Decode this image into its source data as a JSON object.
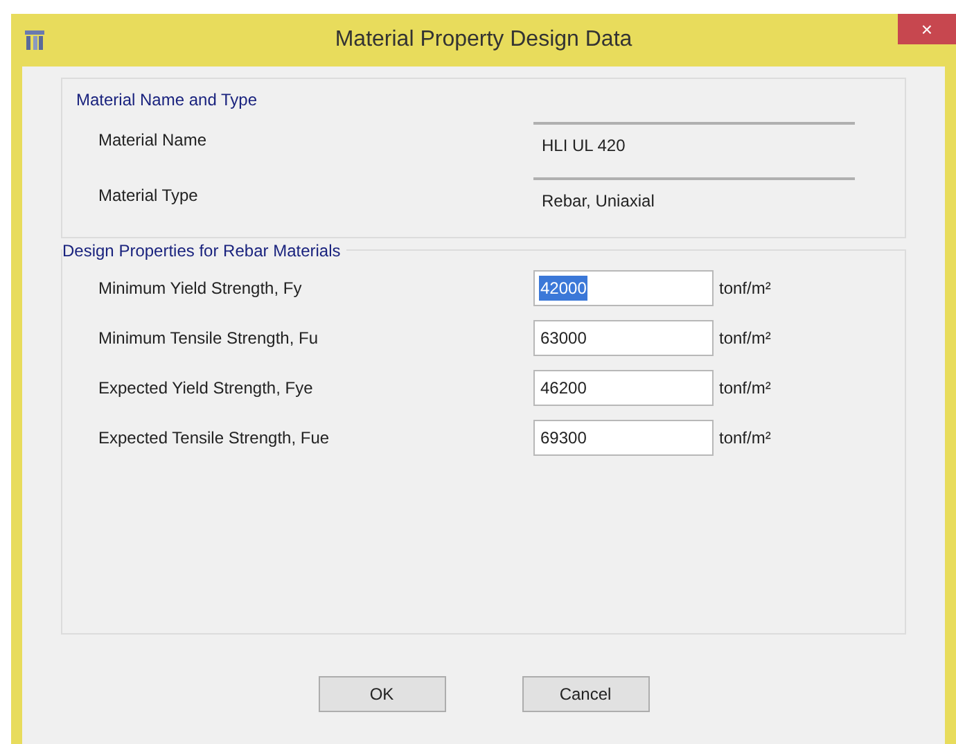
{
  "window": {
    "title": "Material Property Design Data",
    "close": "×"
  },
  "name_type_group": {
    "title": "Material Name and Type",
    "rows": [
      {
        "label": "Material Name",
        "value": "HLI UL 420"
      },
      {
        "label": "Material Type",
        "value": "Rebar, Uniaxial"
      }
    ]
  },
  "design_group": {
    "title": "Design Properties for Rebar Materials",
    "rows": [
      {
        "label": "Minimum Yield Strength, Fy",
        "value": "42000",
        "unit": "tonf/m²",
        "selected": true
      },
      {
        "label": "Minimum Tensile Strength, Fu",
        "value": "63000",
        "unit": "tonf/m²",
        "selected": false
      },
      {
        "label": "Expected Yield Strength, Fye",
        "value": "46200",
        "unit": "tonf/m²",
        "selected": false
      },
      {
        "label": "Expected Tensile Strength, Fue",
        "value": "69300",
        "unit": "tonf/m²",
        "selected": false
      }
    ]
  },
  "buttons": [
    "OK",
    "Cancel"
  ]
}
